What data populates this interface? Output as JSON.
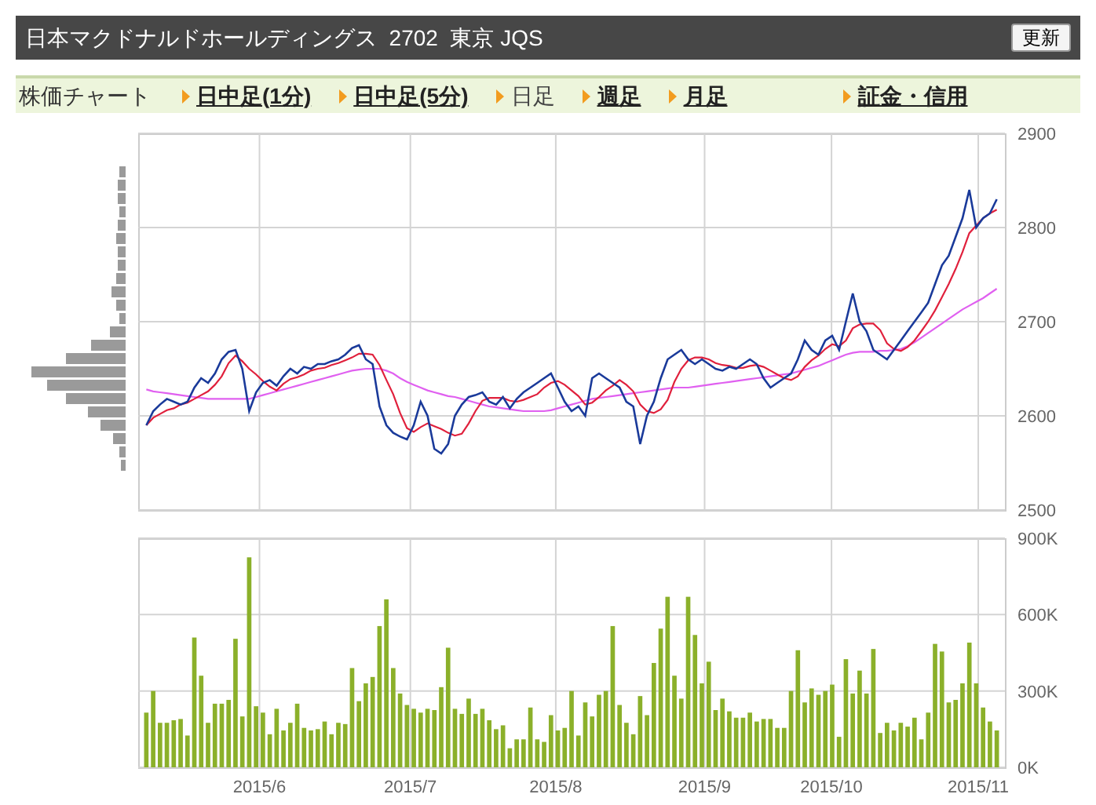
{
  "header": {
    "title": "日本マクドナルドホールディングス  2702  東京 JQS",
    "refresh_button": "更新"
  },
  "nav": {
    "label": "株価チャート",
    "tabs": [
      {
        "label": "日中足(1分)",
        "selected": false
      },
      {
        "label": "日中足(5分)",
        "selected": false
      },
      {
        "label": "日足",
        "selected": true
      },
      {
        "label": "週足",
        "selected": false
      },
      {
        "label": "月足",
        "selected": false
      },
      {
        "label": "証金・信用",
        "selected": false
      }
    ]
  },
  "price_chart": {
    "chart_data": {
      "type": "line",
      "ylim": [
        2500,
        2900
      ],
      "yticks": [
        2500,
        2600,
        2700,
        2800,
        2900
      ],
      "grid": true,
      "series": [
        {
          "color": "#1a3a9a",
          "values": [
            2590,
            2605,
            2612,
            2618,
            2615,
            2612,
            2615,
            2630,
            2640,
            2635,
            2645,
            2660,
            2668,
            2670,
            2650,
            2605,
            2625,
            2635,
            2638,
            2632,
            2642,
            2650,
            2645,
            2652,
            2650,
            2655,
            2655,
            2658,
            2660,
            2665,
            2672,
            2675,
            2660,
            2655,
            2610,
            2590,
            2582,
            2578,
            2575,
            2590,
            2615,
            2600,
            2565,
            2560,
            2570,
            2600,
            2612,
            2620,
            2622,
            2625,
            2615,
            2612,
            2620,
            2608,
            2618,
            2625,
            2630,
            2635,
            2640,
            2645,
            2630,
            2615,
            2605,
            2610,
            2600,
            2640,
            2645,
            2640,
            2635,
            2630,
            2615,
            2610,
            2570,
            2600,
            2615,
            2640,
            2660,
            2665,
            2670,
            2660,
            2655,
            2660,
            2655,
            2650,
            2648,
            2652,
            2650,
            2655,
            2660,
            2655,
            2640,
            2630,
            2635,
            2640,
            2645,
            2660,
            2680,
            2670,
            2665,
            2680,
            2685,
            2670,
            2700,
            2730,
            2700,
            2690,
            2670,
            2665,
            2660,
            2670,
            2680,
            2690,
            2700,
            2710,
            2720,
            2740,
            2760,
            2770,
            2790,
            2810,
            2840,
            2800,
            2810,
            2815,
            2830
          ]
        },
        {
          "color": "#e0203c",
          "values": [
            2590,
            2598,
            2602,
            2606,
            2608,
            2612,
            2614,
            2618,
            2622,
            2626,
            2633,
            2642,
            2656,
            2664,
            2658,
            2650,
            2644,
            2637,
            2631,
            2627,
            2634,
            2639,
            2641,
            2644,
            2648,
            2650,
            2651,
            2654,
            2656,
            2659,
            2662,
            2666,
            2666,
            2665,
            2654,
            2638,
            2623,
            2603,
            2587,
            2583,
            2588,
            2592,
            2589,
            2586,
            2582,
            2579,
            2581,
            2592,
            2605,
            2616,
            2619,
            2619,
            2619,
            2616,
            2615,
            2617,
            2620,
            2623,
            2630,
            2635,
            2637,
            2633,
            2627,
            2621,
            2612,
            2614,
            2620,
            2627,
            2632,
            2638,
            2633,
            2626,
            2612,
            2605,
            2603,
            2607,
            2617,
            2636,
            2650,
            2659,
            2662,
            2662,
            2660,
            2656,
            2654,
            2653,
            2651,
            2651,
            2653,
            2654,
            2652,
            2648,
            2644,
            2640,
            2638,
            2642,
            2652,
            2659,
            2664,
            2671,
            2676,
            2674,
            2680,
            2693,
            2697,
            2698,
            2698,
            2691,
            2677,
            2671,
            2669,
            2673,
            2680,
            2690,
            2700,
            2712,
            2726,
            2740,
            2756,
            2774,
            2794,
            2802,
            2810,
            2815,
            2819
          ]
        },
        {
          "color": "#e060f0",
          "values": [
            2628,
            2626,
            2625,
            2624,
            2623,
            2622,
            2621,
            2620,
            2619,
            2618,
            2618,
            2618,
            2618,
            2618,
            2618,
            2618,
            2620,
            2622,
            2624,
            2626,
            2628,
            2630,
            2632,
            2634,
            2636,
            2638,
            2640,
            2642,
            2644,
            2646,
            2648,
            2649,
            2650,
            2650,
            2650,
            2648,
            2645,
            2640,
            2636,
            2633,
            2630,
            2627,
            2625,
            2623,
            2621,
            2620,
            2618,
            2616,
            2614,
            2612,
            2610,
            2609,
            2608,
            2607,
            2606,
            2605,
            2605,
            2605,
            2605,
            2606,
            2608,
            2610,
            2612,
            2614,
            2616,
            2618,
            2619,
            2620,
            2621,
            2622,
            2623,
            2624,
            2625,
            2626,
            2627,
            2628,
            2629,
            2630,
            2630,
            2630,
            2631,
            2632,
            2633,
            2634,
            2635,
            2636,
            2637,
            2638,
            2639,
            2640,
            2641,
            2642,
            2643,
            2644,
            2645,
            2647,
            2649,
            2651,
            2653,
            2656,
            2659,
            2662,
            2665,
            2667,
            2668,
            2668,
            2668,
            2669,
            2669,
            2670,
            2671,
            2674,
            2678,
            2683,
            2688,
            2693,
            2698,
            2703,
            2708,
            2713,
            2717,
            2721,
            2725,
            2730,
            2735
          ]
        }
      ]
    }
  },
  "volume_chart": {
    "chart_data": {
      "type": "bar",
      "ylim": [
        0,
        900000
      ],
      "grid": true,
      "yticks": [
        {
          "value": 0,
          "label": "0K"
        },
        {
          "value": 300000,
          "label": "300K"
        },
        {
          "value": 600000,
          "label": "600K"
        },
        {
          "value": 900000,
          "label": "900K"
        }
      ],
      "series": [
        {
          "color": "#8bb02a",
          "values": [
            215000,
            300000,
            175000,
            175000,
            185000,
            190000,
            125000,
            510000,
            360000,
            175000,
            250000,
            250000,
            265000,
            505000,
            200000,
            825000,
            240000,
            215000,
            130000,
            230000,
            145000,
            175000,
            250000,
            155000,
            145000,
            150000,
            180000,
            130000,
            175000,
            170000,
            390000,
            260000,
            330000,
            355000,
            555000,
            660000,
            390000,
            290000,
            245000,
            230000,
            215000,
            230000,
            225000,
            315000,
            470000,
            230000,
            210000,
            270000,
            210000,
            230000,
            185000,
            150000,
            165000,
            75000,
            110000,
            110000,
            235000,
            110000,
            100000,
            205000,
            145000,
            155000,
            300000,
            125000,
            255000,
            200000,
            285000,
            300000,
            555000,
            245000,
            175000,
            130000,
            280000,
            205000,
            410000,
            545000,
            670000,
            360000,
            270000,
            670000,
            520000,
            330000,
            415000,
            225000,
            270000,
            220000,
            195000,
            195000,
            215000,
            180000,
            190000,
            190000,
            155000,
            155000,
            300000,
            460000,
            255000,
            310000,
            285000,
            300000,
            325000,
            120000,
            425000,
            290000,
            380000,
            290000,
            465000,
            135000,
            175000,
            145000,
            175000,
            160000,
            195000,
            110000,
            215000,
            485000,
            455000,
            255000,
            265000,
            330000,
            490000,
            330000,
            235000,
            180000,
            145000
          ]
        }
      ]
    },
    "date_labels": [
      "2015/6",
      "2015/7",
      "2015/8",
      "2015/9",
      "2015/10",
      "2015/11"
    ]
  }
}
